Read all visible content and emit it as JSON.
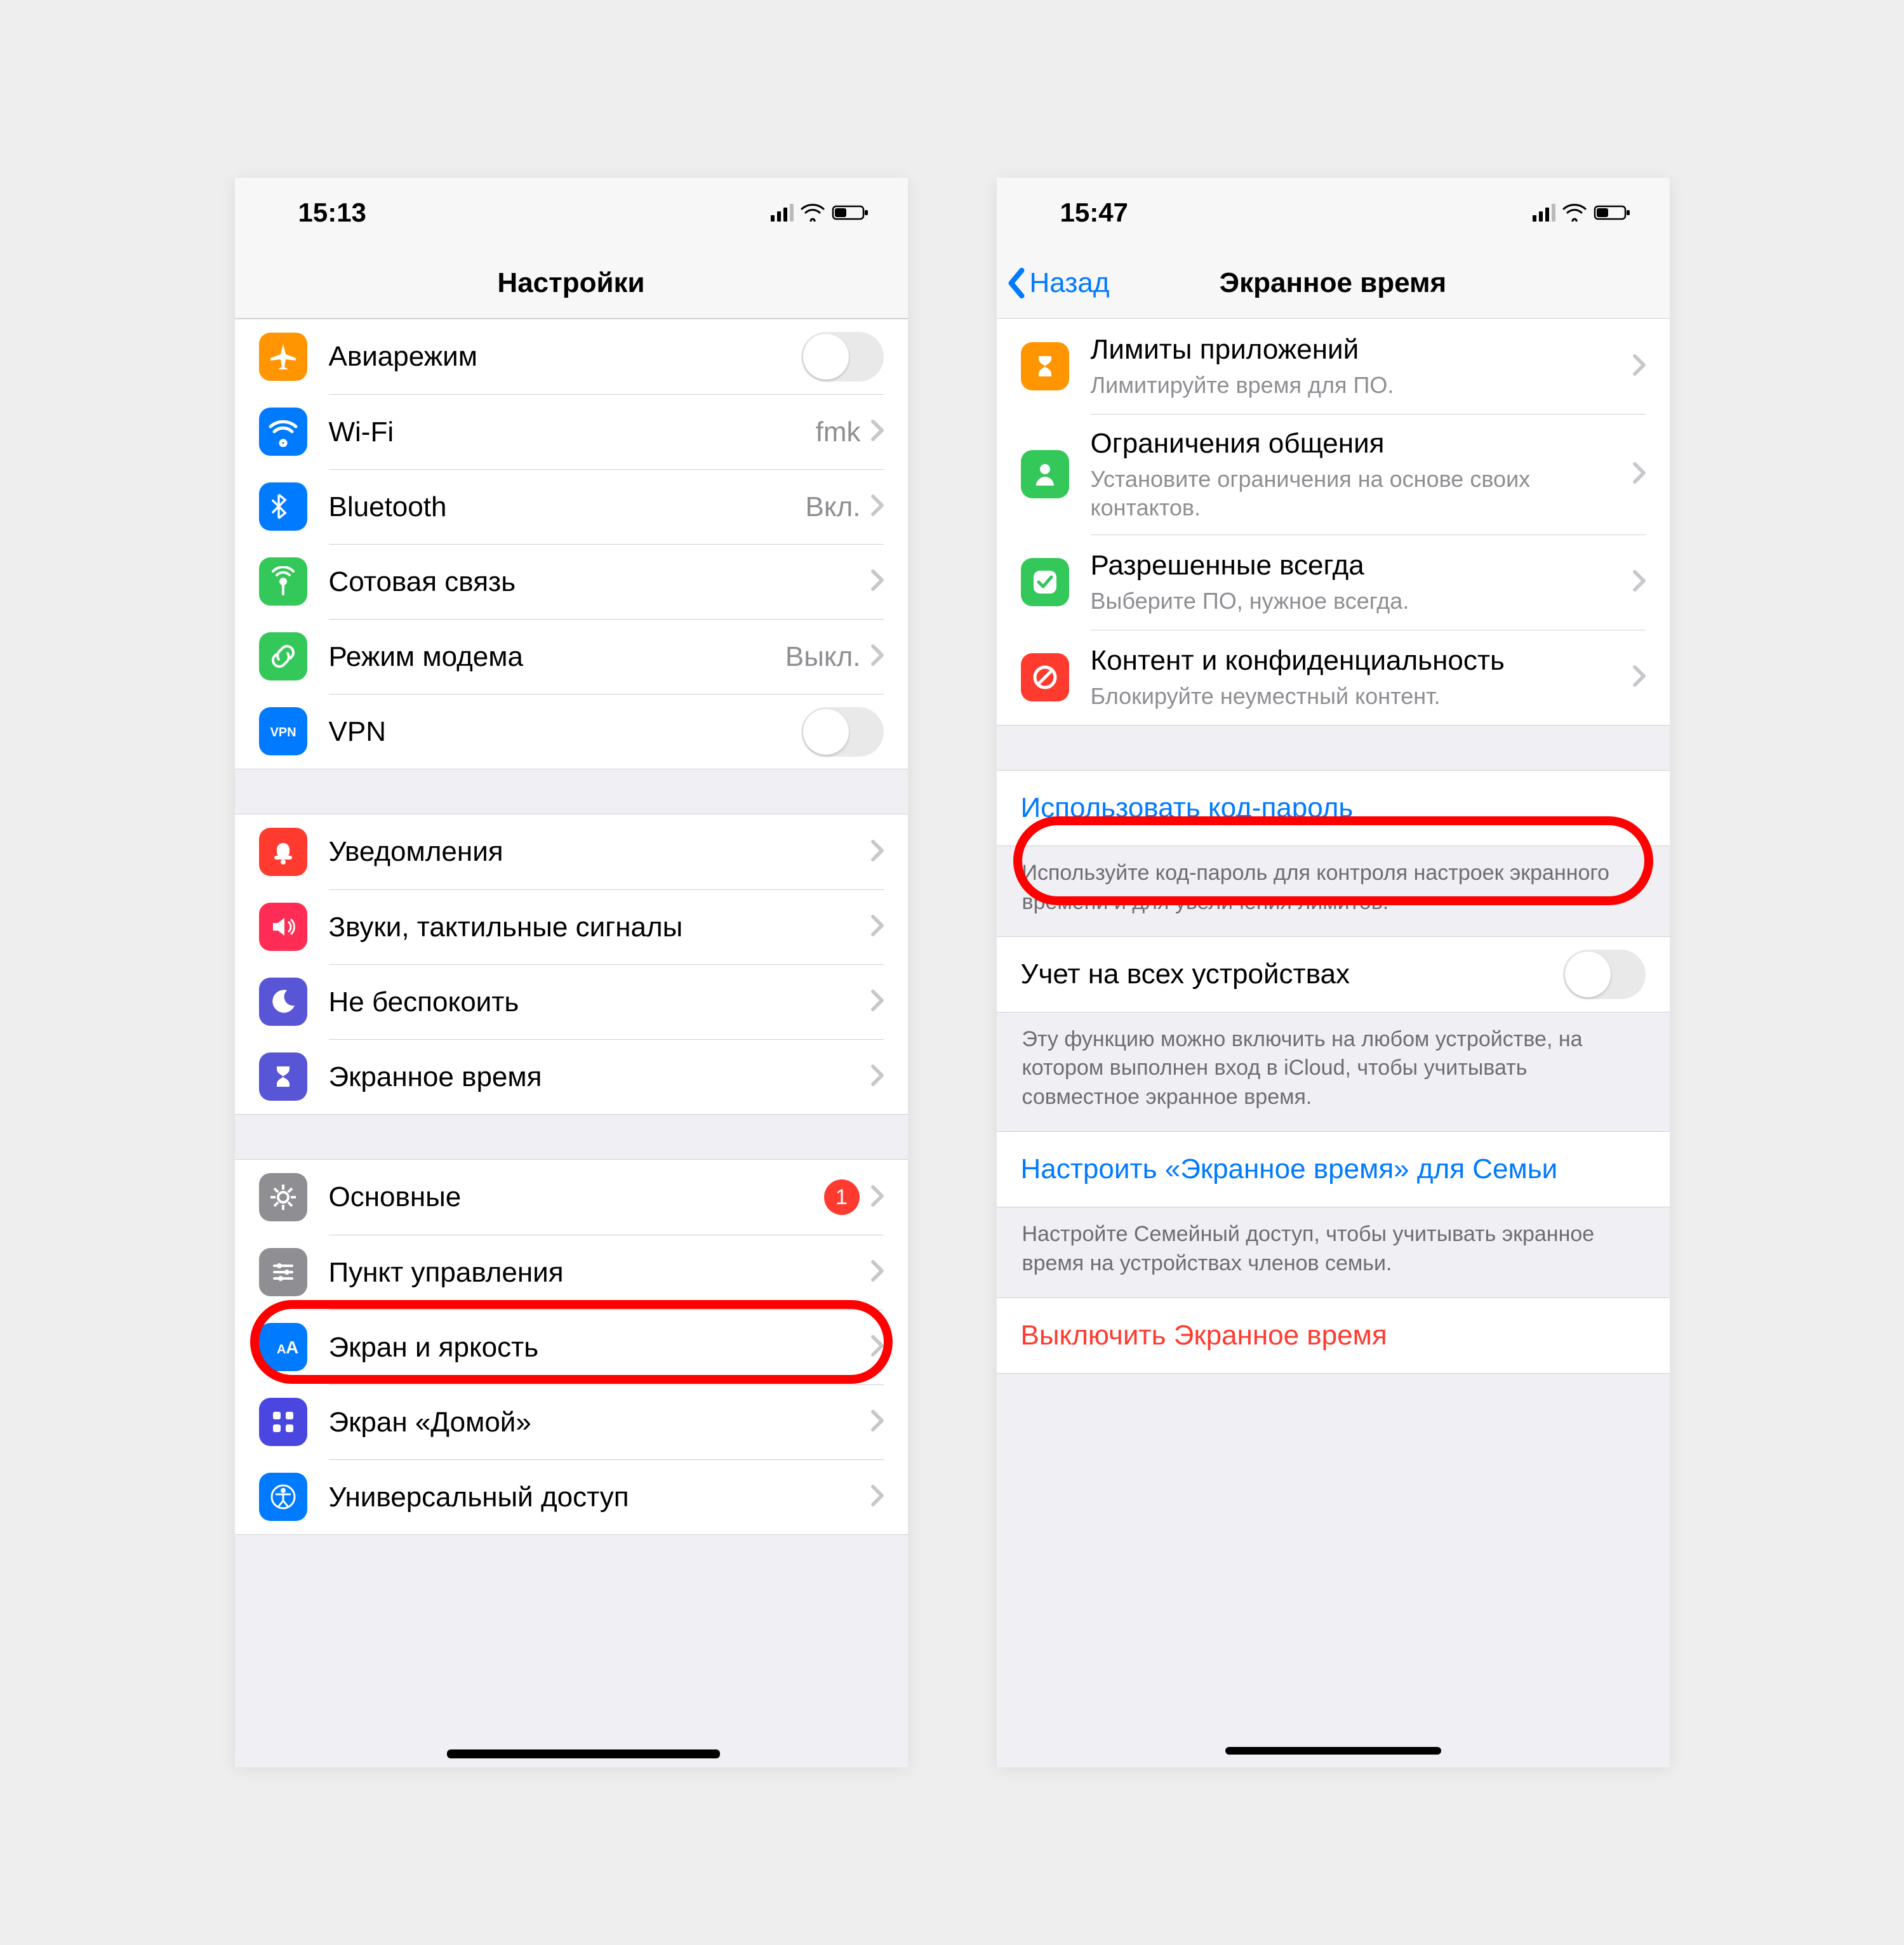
{
  "left": {
    "status_time": "15:13",
    "navbar_title": "Настройки",
    "groups": [
      {
        "rows": [
          {
            "icon": "airplane",
            "bg": "bg-orange",
            "label": "Авиарежим",
            "type": "switch"
          },
          {
            "icon": "wifi",
            "bg": "bg-blue",
            "label": "Wi-Fi",
            "value": "fmk",
            "type": "chevron"
          },
          {
            "icon": "bluetooth",
            "bg": "bg-blue",
            "label": "Bluetooth",
            "value": "Вкл.",
            "type": "chevron"
          },
          {
            "icon": "antenna",
            "bg": "bg-green",
            "label": "Сотовая связь",
            "type": "chevron"
          },
          {
            "icon": "link",
            "bg": "bg-green",
            "label": "Режим модема",
            "value": "Выкл.",
            "type": "chevron"
          },
          {
            "icon": "vpn",
            "bg": "bg-blue",
            "label": "VPN",
            "type": "switch"
          }
        ]
      },
      {
        "rows": [
          {
            "icon": "bell",
            "bg": "bg-red",
            "label": "Уведомления",
            "type": "chevron"
          },
          {
            "icon": "speaker",
            "bg": "bg-pink",
            "label": "Звуки, тактильные сигналы",
            "type": "chevron"
          },
          {
            "icon": "moon",
            "bg": "bg-purple",
            "label": "Не беспокоить",
            "type": "chevron"
          },
          {
            "icon": "hourglass",
            "bg": "bg-indigo",
            "label": "Экранное время",
            "type": "chevron",
            "highlight": true
          }
        ]
      },
      {
        "rows": [
          {
            "icon": "gear",
            "bg": "bg-gray",
            "label": "Основные",
            "badge": "1",
            "type": "chevron"
          },
          {
            "icon": "sliders",
            "bg": "bg-graylt",
            "label": "Пункт управления",
            "type": "chevron"
          },
          {
            "icon": "textsize",
            "bg": "bg-bluebr",
            "label": "Экран и яркость",
            "type": "chevron"
          },
          {
            "icon": "grid",
            "bg": "bg-indigo2",
            "label": "Экран «Домой»",
            "type": "chevron"
          },
          {
            "icon": "accessibility",
            "bg": "bg-bluebr",
            "label": "Универсальный доступ",
            "type": "chevron",
            "redacted": true
          }
        ]
      }
    ]
  },
  "right": {
    "status_time": "15:47",
    "navbar_back": "Назад",
    "navbar_title": "Экранное время",
    "top_rows": [
      {
        "icon": "hourglass",
        "bg": "bg-orange",
        "label": "Лимиты приложений",
        "sub": "Лимитируйте время для ПО.",
        "type": "chevron"
      },
      {
        "icon": "person",
        "bg": "bg-green",
        "label": "Ограничения общения",
        "sub": "Установите ограничения на основе своих контактов.",
        "type": "chevron"
      },
      {
        "icon": "check",
        "bg": "bg-green",
        "label": "Разрешенные всегда",
        "sub": "Выберите ПО, нужное всегда.",
        "type": "chevron"
      },
      {
        "icon": "nosign",
        "bg": "bg-red",
        "label": "Контент и конфиденциальность",
        "sub": "Блокируйте неуместный контент.",
        "type": "chevron"
      }
    ],
    "passcode": {
      "label": "Использовать код-пароль",
      "footer": "Используйте код-пароль для контроля настроек экранного времени и для увеличения лимитов."
    },
    "share": {
      "label": "Учет на всех устройствах",
      "footer": "Эту функцию можно включить на любом устройстве, на котором выполнен вход в iCloud, чтобы учитывать совместное экранное время."
    },
    "family": {
      "label": "Настроить «Экранное время» для Семьи",
      "footer": "Настройте Семейный доступ, чтобы учитывать экранное время на устройствах членов семьи."
    },
    "turnoff": {
      "label": "Выключить Экранное время"
    }
  }
}
